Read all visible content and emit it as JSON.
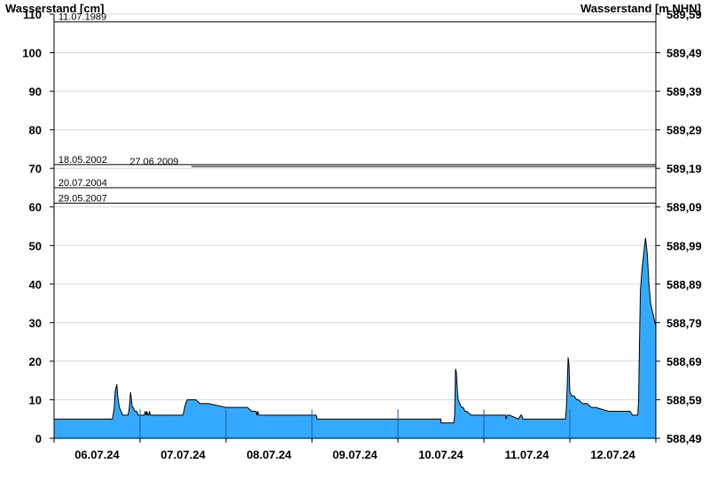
{
  "chart_data": {
    "type": "area",
    "left_axis_title": "Wasserstand [cm]",
    "right_axis_title": "Wasserstand [m NHN]",
    "ylim": [
      0,
      110
    ],
    "y_ticks": [
      0,
      10,
      20,
      30,
      40,
      50,
      60,
      70,
      80,
      90,
      100,
      110
    ],
    "y_tick_labels": [
      "0",
      "10",
      "20",
      "30",
      "40",
      "50",
      "60",
      "70",
      "80",
      "90",
      "100",
      "110"
    ],
    "right_tick_labels": [
      "588,49",
      "588,59",
      "588,69",
      "588,79",
      "588,89",
      "588,99",
      "589,09",
      "589,19",
      "589,29",
      "589,39",
      "589,49",
      "589,59"
    ],
    "xlim": [
      0,
      7
    ],
    "x_ticks": [
      0.5,
      1.5,
      2.5,
      3.5,
      4.5,
      5.5,
      6.5
    ],
    "x_tick_labels": [
      "06.07.24",
      "07.07.24",
      "08.07.24",
      "09.07.24",
      "10.07.24",
      "11.07.24",
      "12.07.24"
    ],
    "day_dividers": [
      1,
      2,
      3,
      4,
      5,
      6
    ],
    "grid": true,
    "fill_color": "#33aaff",
    "line_color": "#000000",
    "reference_lines": [
      {
        "label": "11.07.1989",
        "y": 108,
        "x_start": 0,
        "label_x": 0.05
      },
      {
        "label": "18.05.2002",
        "y": 71,
        "x_start": 0,
        "label_x": 0.05
      },
      {
        "label": "27.06.2009",
        "y": 70.5,
        "x_start": 1.6,
        "label_x": 0.88
      },
      {
        "label": "20.07.2004",
        "y": 65,
        "x_start": 0,
        "label_x": 0.05
      },
      {
        "label": "29.05.2007",
        "y": 61,
        "x_start": 0,
        "label_x": 0.05
      }
    ],
    "series": [
      {
        "x": [
          0,
          0.68,
          0.7,
          0.71,
          0.72,
          0.73,
          0.74,
          0.76,
          0.78,
          0.8,
          0.82,
          0.84,
          0.86,
          0.87,
          0.88,
          0.89,
          0.9,
          0.91,
          0.92,
          0.94,
          0.96,
          0.98,
          1.0,
          1.05,
          1.06,
          1.07,
          1.08,
          1.09,
          1.1,
          1.11,
          1.12,
          1.2,
          1.5,
          1.52,
          1.53,
          1.55,
          1.58,
          1.65,
          1.7,
          1.8,
          2.0,
          2.25,
          2.3,
          2.35,
          2.36,
          2.37,
          2.38,
          2.4,
          2.5,
          2.98,
          3.0,
          3.05,
          3.06,
          3.08,
          3.1,
          3.5,
          4.48,
          4.5,
          4.5,
          4.6,
          4.65,
          4.66,
          4.67,
          4.68,
          4.69,
          4.7,
          4.72,
          4.74,
          4.76,
          4.78,
          4.8,
          4.85,
          5.0,
          5.2,
          5.25,
          5.26,
          5.27,
          5.3,
          5.4,
          5.43,
          5.44,
          5.45,
          5.46,
          5.5,
          5.95,
          5.96,
          5.97,
          5.98,
          5.99,
          6.0,
          6.02,
          6.05,
          6.08,
          6.1,
          6.15,
          6.2,
          6.25,
          6.3,
          6.45,
          6.5,
          6.7,
          6.73,
          6.74,
          6.76,
          6.78,
          6.79,
          6.8,
          6.81,
          6.82,
          6.84,
          6.86,
          6.88,
          6.9,
          6.92,
          6.94,
          6.96,
          6.98,
          7.0
        ],
        "y": [
          5,
          5,
          8,
          12,
          13,
          14,
          11,
          8,
          7,
          6,
          6,
          6,
          6,
          7,
          9,
          12,
          10,
          8,
          8,
          7,
          7,
          6,
          6,
          6,
          7,
          6,
          7,
          6,
          6,
          7,
          6,
          6,
          6,
          8,
          9,
          10,
          10,
          10,
          9,
          9,
          8,
          8,
          7,
          7,
          6,
          7,
          6,
          6,
          6,
          6,
          6,
          6,
          5,
          5,
          5,
          5,
          5,
          5,
          4,
          4,
          4,
          6,
          18,
          17,
          13,
          10,
          9,
          8,
          8,
          7,
          7,
          6,
          6,
          6,
          6,
          5,
          6,
          6,
          5,
          6,
          6,
          5,
          5,
          5,
          5,
          8,
          14,
          21,
          19,
          12,
          11,
          11,
          10,
          10,
          9,
          9,
          8,
          8,
          7,
          7,
          7,
          6,
          6,
          6,
          6,
          6,
          10,
          25,
          38,
          44,
          48,
          52,
          48,
          40,
          35,
          33,
          31,
          29
        ]
      }
    ]
  }
}
